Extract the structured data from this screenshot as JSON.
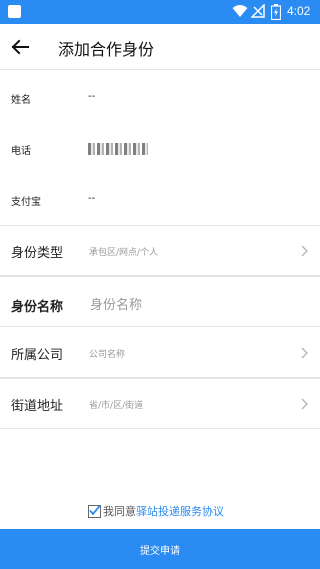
{
  "status_bar": {
    "time": "4:02",
    "icons": [
      "notification-square-icon",
      "wifi-icon",
      "no-signal-icon",
      "battery-charging-icon"
    ],
    "background": "#2a8bf2"
  },
  "header": {
    "title": "添加合作身份",
    "back_icon": "arrow-left-icon"
  },
  "info": {
    "name": {
      "label": "姓名",
      "value": "--"
    },
    "phone": {
      "label": "电话",
      "value": "(masked)"
    },
    "alipay": {
      "label": "支付宝",
      "value": "--"
    }
  },
  "form": {
    "identity_type": {
      "label": "身份类型",
      "placeholder": "承包区/网点/个人"
    },
    "identity_name": {
      "label": "身份名称",
      "placeholder": "身份名称"
    },
    "company": {
      "label": "所属公司",
      "placeholder": "公司名称"
    },
    "street_address": {
      "label": "街道地址",
      "placeholder": "省/市/区/街道"
    }
  },
  "agreement": {
    "prefix": "我同意",
    "link": "驿站投递服务协议",
    "checked": true
  },
  "submit": {
    "label": "提交申请"
  },
  "colors": {
    "accent": "#2a8bf2",
    "hint": "#9a9a9a",
    "divider": "#e8e8e8"
  }
}
